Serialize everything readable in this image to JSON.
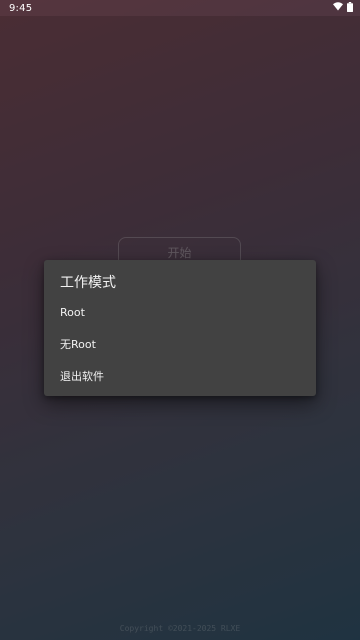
{
  "status_bar": {
    "time": "9:45",
    "icons": [
      "wifi-icon",
      "battery-icon"
    ]
  },
  "main": {
    "start_label": "开始",
    "footer": "Copyright ©2021-2025 RLXE"
  },
  "dialog": {
    "title": "工作模式",
    "items": [
      {
        "label": "Root"
      },
      {
        "label": "无Root"
      },
      {
        "label": "退出软件"
      }
    ]
  },
  "colors": {
    "dialog_bg": "#424242",
    "gradient_top": "#6e434d",
    "gradient_bottom": "#2f4c60"
  }
}
